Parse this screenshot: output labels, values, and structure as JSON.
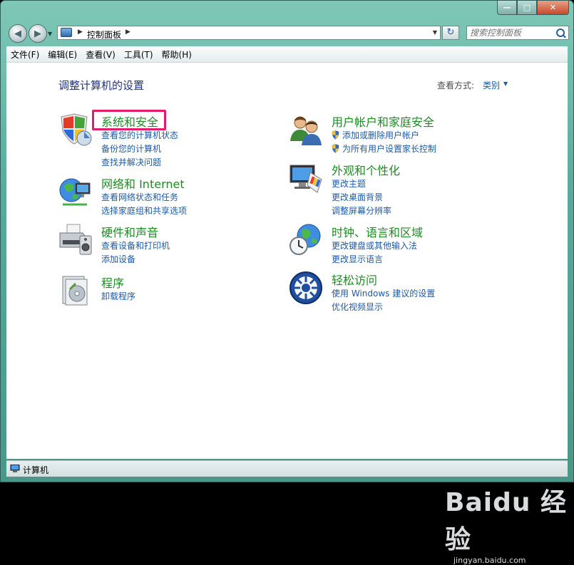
{
  "window": {
    "address_path": "控制面板",
    "search_placeholder": "搜索控制面板"
  },
  "menubar": {
    "items": [
      "文件(F)",
      "编辑(E)",
      "查看(V)",
      "工具(T)",
      "帮助(H)"
    ]
  },
  "main": {
    "title": "调整计算机的设置",
    "view_by_label": "查看方式:",
    "view_by_value": "类别"
  },
  "categories": [
    {
      "title": "系统和安全",
      "links": [
        "查看您的计算机状态",
        "备份您的计算机",
        "查找并解决问题"
      ],
      "icon": "shield-icon",
      "highlighted": true
    },
    {
      "title": "网络和 Internet",
      "links": [
        "查看网络状态和任务",
        "选择家庭组和共享选项"
      ],
      "icon": "network-globe-icon"
    },
    {
      "title": "硬件和声音",
      "links": [
        "查看设备和打印机",
        "添加设备"
      ],
      "icon": "printer-icon"
    },
    {
      "title": "程序",
      "links": [
        "卸载程序"
      ],
      "icon": "programs-icon"
    },
    {
      "title": "用户帐户和家庭安全",
      "links": [
        "添加或删除用户帐户",
        "为所有用户设置家长控制"
      ],
      "icon": "users-icon",
      "link_shields": true
    },
    {
      "title": "外观和个性化",
      "links": [
        "更改主题",
        "更改桌面背景",
        "调整屏幕分辨率"
      ],
      "icon": "monitor-paint-icon"
    },
    {
      "title": "时钟、语言和区域",
      "links": [
        "更改键盘或其他输入法",
        "更改显示语言"
      ],
      "icon": "clock-globe-icon"
    },
    {
      "title": "轻松访问",
      "links": [
        "使用 Windows 建议的设置",
        "优化视频显示"
      ],
      "icon": "ease-of-access-icon"
    }
  ],
  "statusbar": {
    "text": "计算机"
  },
  "watermark": {
    "logo": "Baidu 经验",
    "url": "jingyan.baidu.com"
  },
  "colors": {
    "category_title": "#1e8b25",
    "link": "#1e5aa6",
    "highlight_box": "#e31b6d",
    "frame": "#5aa99c"
  }
}
